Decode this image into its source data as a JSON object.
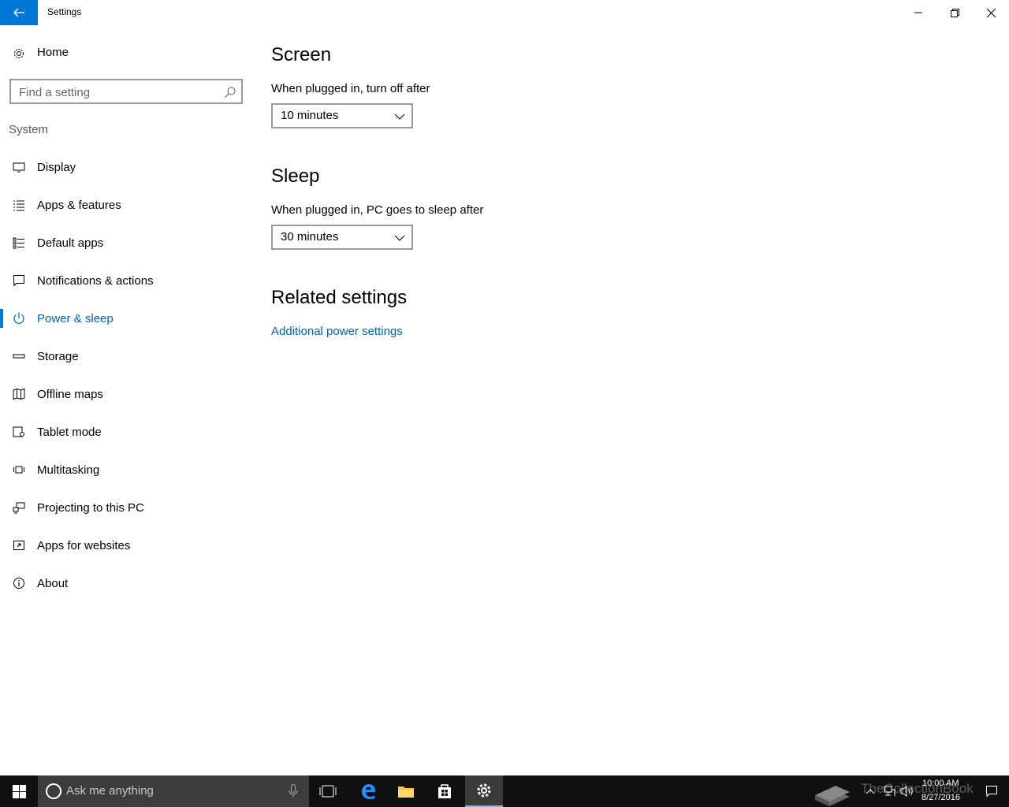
{
  "window": {
    "title": "Settings"
  },
  "sidebar": {
    "home_label": "Home",
    "search_placeholder": "Find a setting",
    "section_label": "System",
    "items": [
      {
        "label": "Display",
        "icon": "display-icon"
      },
      {
        "label": "Apps & features",
        "icon": "apps-features-icon"
      },
      {
        "label": "Default apps",
        "icon": "default-apps-icon"
      },
      {
        "label": "Notifications & actions",
        "icon": "notifications-icon"
      },
      {
        "label": "Power & sleep",
        "icon": "power-icon",
        "active": true
      },
      {
        "label": "Storage",
        "icon": "storage-icon"
      },
      {
        "label": "Offline maps",
        "icon": "map-icon"
      },
      {
        "label": "Tablet mode",
        "icon": "tablet-mode-icon"
      },
      {
        "label": "Multitasking",
        "icon": "multitasking-icon"
      },
      {
        "label": "Projecting to this PC",
        "icon": "projecting-icon"
      },
      {
        "label": "Apps for websites",
        "icon": "apps-websites-icon"
      },
      {
        "label": "About",
        "icon": "info-icon"
      }
    ]
  },
  "main": {
    "screen_heading": "Screen",
    "screen_label": "When plugged in, turn off after",
    "screen_value": "10 minutes",
    "sleep_heading": "Sleep",
    "sleep_label": "When plugged in, PC goes to sleep after",
    "sleep_value": "30 minutes",
    "related_heading": "Related settings",
    "related_link": "Additional power settings"
  },
  "taskbar": {
    "search_placeholder": "Ask me anything",
    "watermark": "TheCollectionBook",
    "time": "10:00 AM",
    "date": "8/27/2016"
  },
  "colors": {
    "accent": "#0078d7",
    "link": "#0063b1",
    "taskbar": "#101010"
  }
}
